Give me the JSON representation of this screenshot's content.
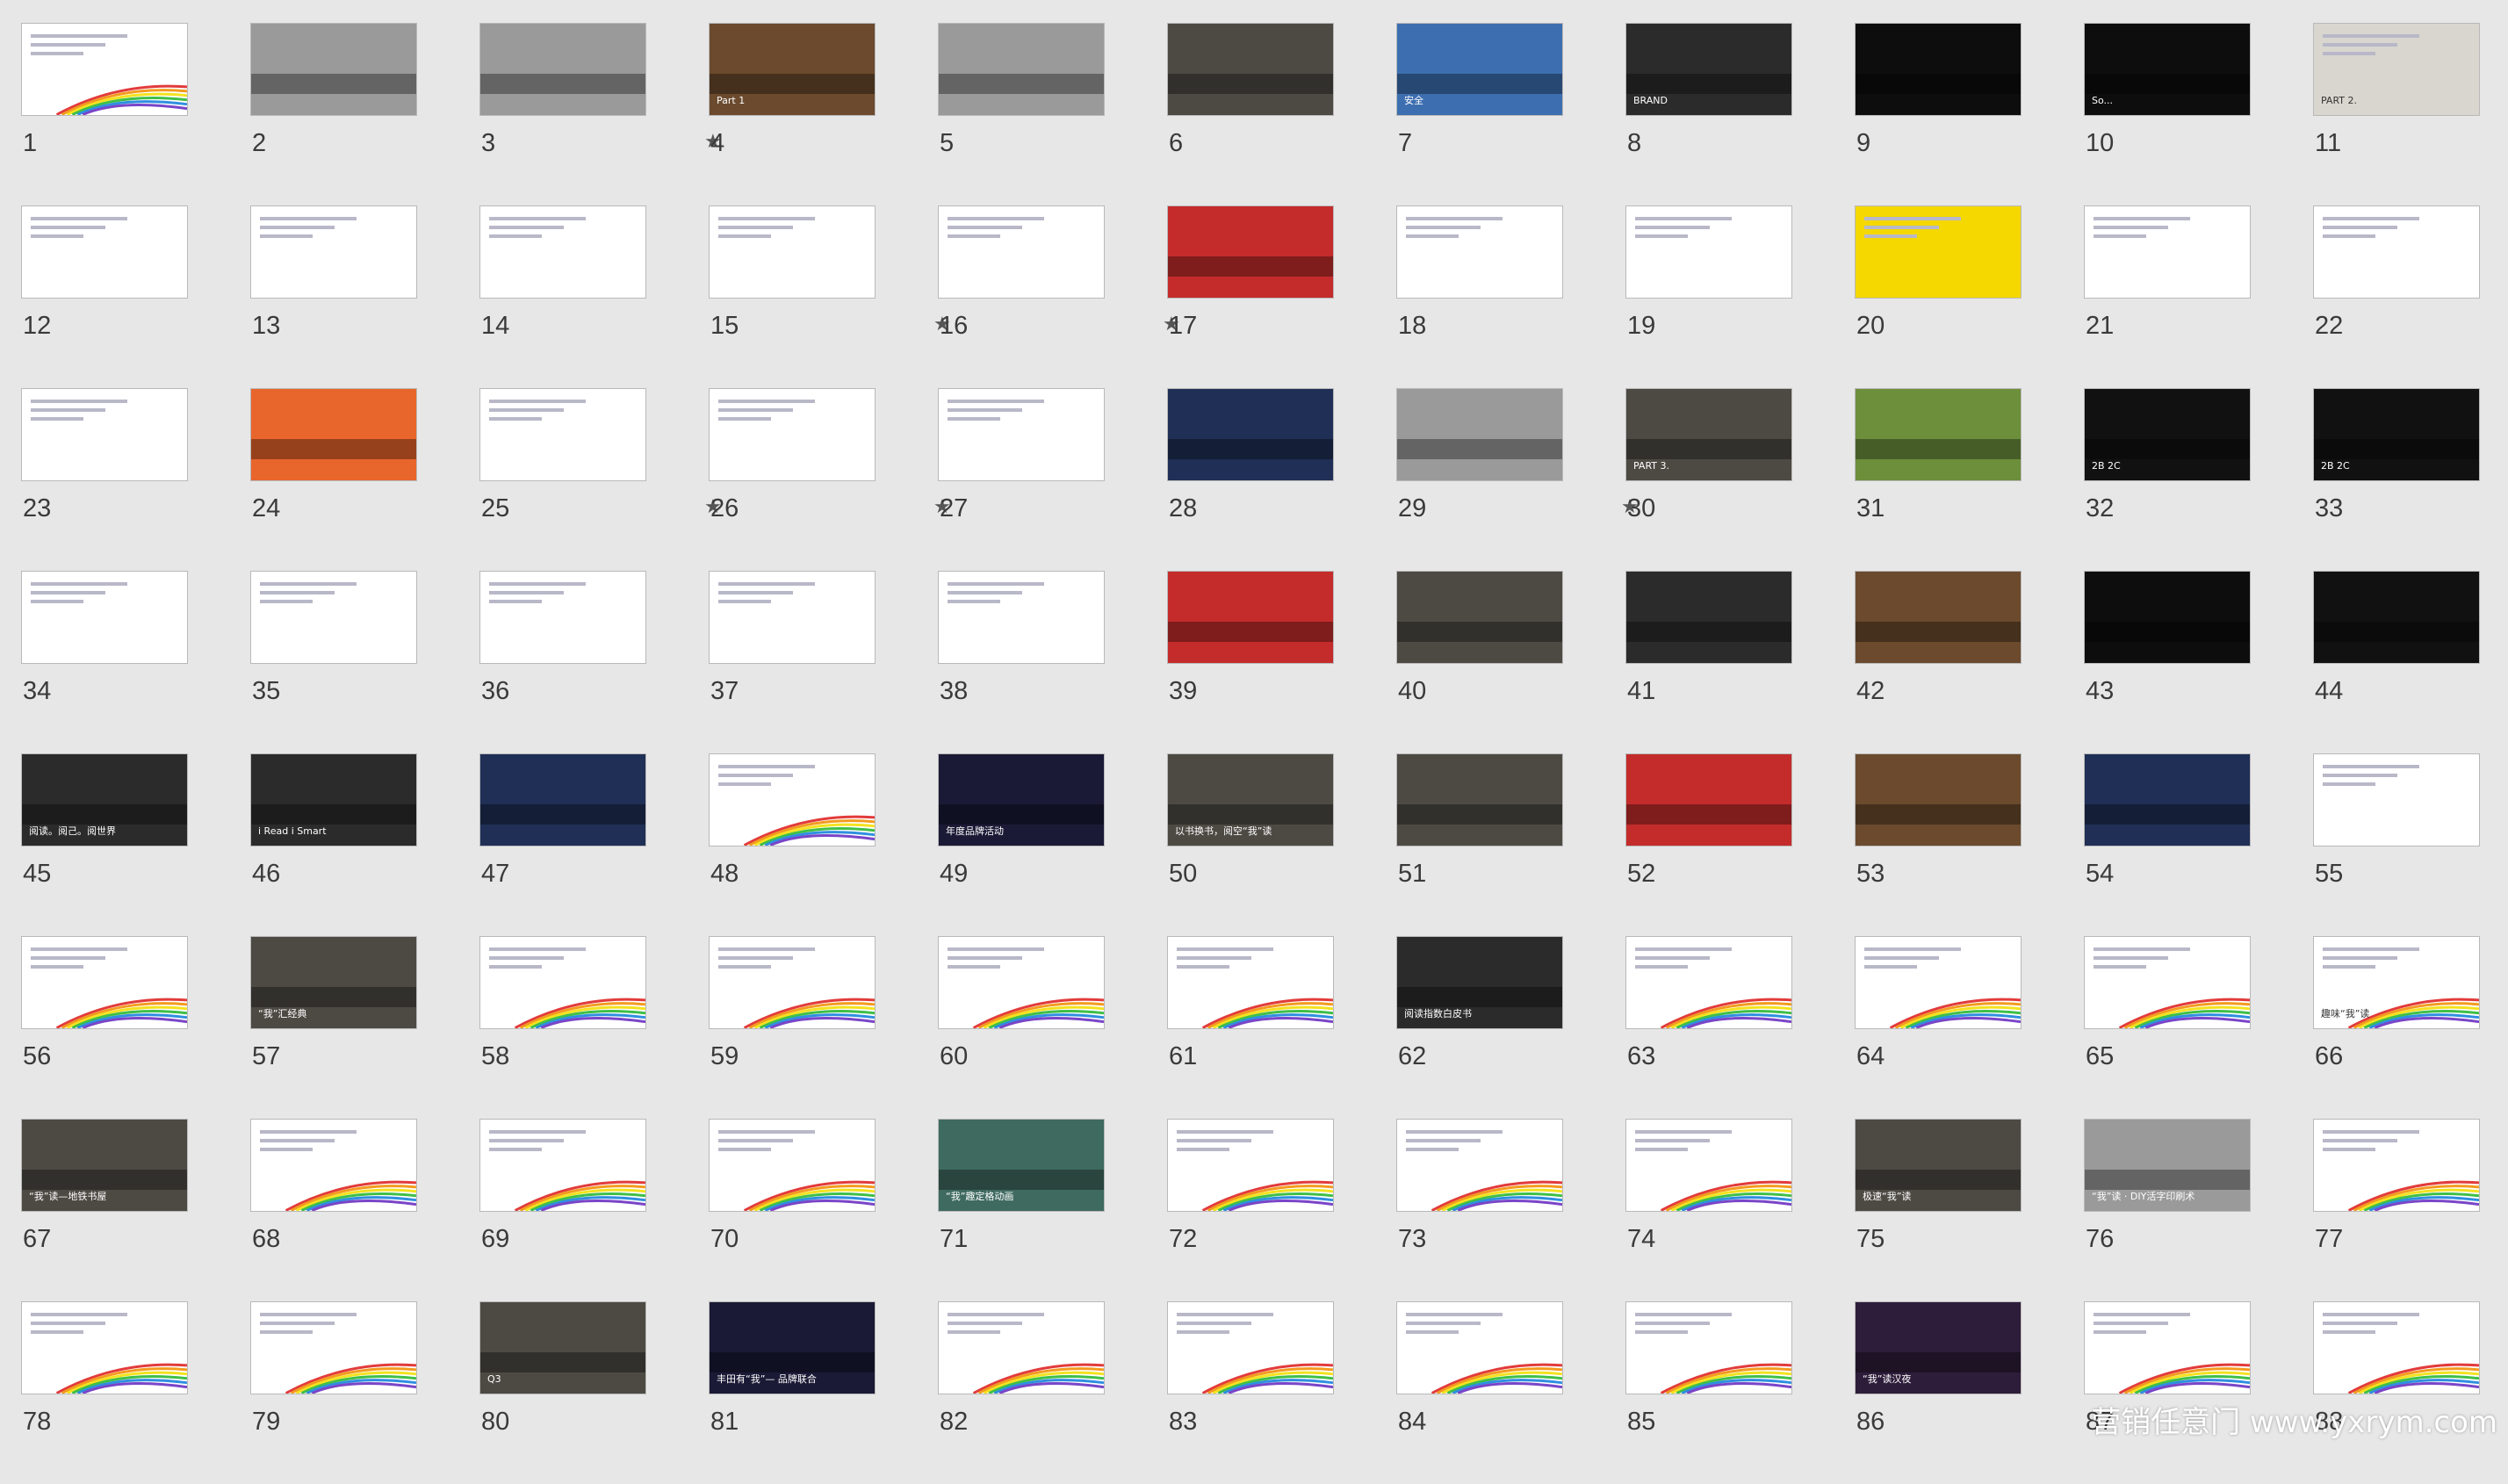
{
  "slides": [
    {
      "n": "1",
      "theme": "rainbow",
      "text": ""
    },
    {
      "n": "2",
      "theme": "gray",
      "text": ""
    },
    {
      "n": "3",
      "theme": "gray",
      "text": "",
      "star": true
    },
    {
      "n": "4",
      "theme": "brown",
      "text": "Part 1"
    },
    {
      "n": "5",
      "theme": "gray",
      "text": ""
    },
    {
      "n": "6",
      "theme": "photo",
      "text": ""
    },
    {
      "n": "7",
      "theme": "blue",
      "text": "安全"
    },
    {
      "n": "8",
      "theme": "dark",
      "text": "BRAND"
    },
    {
      "n": "9",
      "theme": "black",
      "text": ""
    },
    {
      "n": "10",
      "theme": "black",
      "text": "So..."
    },
    {
      "n": "11",
      "theme": "light",
      "text": "PART 2."
    },
    {
      "n": "12",
      "theme": "white",
      "text": ""
    },
    {
      "n": "13",
      "theme": "white",
      "text": ""
    },
    {
      "n": "14",
      "theme": "white",
      "text": ""
    },
    {
      "n": "15",
      "theme": "white",
      "text": "",
      "star": true
    },
    {
      "n": "16",
      "theme": "white",
      "text": "",
      "star": true
    },
    {
      "n": "17",
      "theme": "red",
      "text": ""
    },
    {
      "n": "18",
      "theme": "white",
      "text": ""
    },
    {
      "n": "19",
      "theme": "white",
      "text": ""
    },
    {
      "n": "20",
      "theme": "yellow",
      "text": ""
    },
    {
      "n": "21",
      "theme": "white",
      "text": ""
    },
    {
      "n": "22",
      "theme": "white",
      "text": ""
    },
    {
      "n": "23",
      "theme": "white",
      "text": ""
    },
    {
      "n": "24",
      "theme": "orange",
      "text": ""
    },
    {
      "n": "25",
      "theme": "circle",
      "text": "",
      "star": true
    },
    {
      "n": "26",
      "theme": "pyramid",
      "text": "",
      "star": true
    },
    {
      "n": "27",
      "theme": "white",
      "text": ""
    },
    {
      "n": "28",
      "theme": "navy",
      "text": ""
    },
    {
      "n": "29",
      "theme": "gray",
      "text": "",
      "star": true
    },
    {
      "n": "30",
      "theme": "photo",
      "text": "PART 3."
    },
    {
      "n": "31",
      "theme": "green",
      "text": ""
    },
    {
      "n": "32",
      "theme": "bw",
      "text": "2B  2C"
    },
    {
      "n": "33",
      "theme": "bw",
      "text": "2B  2C"
    },
    {
      "n": "34",
      "theme": "pie",
      "text": ""
    },
    {
      "n": "35",
      "theme": "bars",
      "text": ""
    },
    {
      "n": "36",
      "theme": "bars",
      "text": ""
    },
    {
      "n": "37",
      "theme": "white",
      "text": ""
    },
    {
      "n": "38",
      "theme": "white",
      "text": ""
    },
    {
      "n": "39",
      "theme": "red",
      "text": ""
    },
    {
      "n": "40",
      "theme": "photo",
      "text": ""
    },
    {
      "n": "41",
      "theme": "dark",
      "text": ""
    },
    {
      "n": "42",
      "theme": "brown",
      "text": ""
    },
    {
      "n": "43",
      "theme": "black",
      "text": ""
    },
    {
      "n": "44",
      "theme": "bw",
      "text": ""
    },
    {
      "n": "45",
      "theme": "dark",
      "text": "阅读。阅己。阅世界"
    },
    {
      "n": "46",
      "theme": "dark",
      "text": "i Read  i Smart"
    },
    {
      "n": "47",
      "theme": "navy",
      "text": ""
    },
    {
      "n": "48",
      "theme": "rainbow",
      "text": ""
    },
    {
      "n": "49",
      "theme": "night",
      "text": "年度品牌活动"
    },
    {
      "n": "50",
      "theme": "photo",
      "text": "以书换书，阅空“我”读"
    },
    {
      "n": "51",
      "theme": "photo",
      "text": ""
    },
    {
      "n": "52",
      "theme": "red",
      "text": ""
    },
    {
      "n": "53",
      "theme": "brown",
      "text": ""
    },
    {
      "n": "54",
      "theme": "navy",
      "text": ""
    },
    {
      "n": "55",
      "theme": "white",
      "text": ""
    },
    {
      "n": "56",
      "theme": "rainbow",
      "text": ""
    },
    {
      "n": "57",
      "theme": "photo",
      "text": "“我”汇经典"
    },
    {
      "n": "58",
      "theme": "rainbow",
      "text": ""
    },
    {
      "n": "59",
      "theme": "rainbow",
      "text": ""
    },
    {
      "n": "60",
      "theme": "rainbow",
      "text": ""
    },
    {
      "n": "61",
      "theme": "rainbow",
      "text": ""
    },
    {
      "n": "62",
      "theme": "dark",
      "text": "阅读指数白皮书"
    },
    {
      "n": "63",
      "theme": "rainbow",
      "text": ""
    },
    {
      "n": "64",
      "theme": "rainbow",
      "text": ""
    },
    {
      "n": "65",
      "theme": "rainbow",
      "text": ""
    },
    {
      "n": "66",
      "theme": "rainbow",
      "text": "趣味“我”读"
    },
    {
      "n": "67",
      "theme": "photo",
      "text": "“我”读—地铁书屋"
    },
    {
      "n": "68",
      "theme": "rainbow",
      "text": ""
    },
    {
      "n": "69",
      "theme": "rainbow",
      "text": ""
    },
    {
      "n": "70",
      "theme": "rainbow",
      "text": ""
    },
    {
      "n": "71",
      "theme": "teal",
      "text": "“我”趣定格动画"
    },
    {
      "n": "72",
      "theme": "rainbow",
      "text": ""
    },
    {
      "n": "73",
      "theme": "rainbow",
      "text": ""
    },
    {
      "n": "74",
      "theme": "rainbow",
      "text": ""
    },
    {
      "n": "75",
      "theme": "photo",
      "text": "极速“我”读"
    },
    {
      "n": "76",
      "theme": "gray",
      "text": "“我”读 · DIY活字印刷术"
    },
    {
      "n": "77",
      "theme": "rainbow",
      "text": ""
    },
    {
      "n": "78",
      "theme": "rainbow",
      "text": ""
    },
    {
      "n": "79",
      "theme": "rainbow",
      "text": ""
    },
    {
      "n": "80",
      "theme": "photo",
      "text": "Q3"
    },
    {
      "n": "81",
      "theme": "night",
      "text": "丰田有“我”— 品牌联合"
    },
    {
      "n": "82",
      "theme": "rainbow",
      "text": ""
    },
    {
      "n": "83",
      "theme": "rainbow",
      "text": ""
    },
    {
      "n": "84",
      "theme": "rainbow",
      "text": ""
    },
    {
      "n": "85",
      "theme": "rainbow",
      "text": ""
    },
    {
      "n": "86",
      "theme": "space",
      "text": "“我”读汉夜"
    },
    {
      "n": "87",
      "theme": "rainbow",
      "text": ""
    },
    {
      "n": "88",
      "theme": "rainbow",
      "text": ""
    }
  ],
  "themes": {
    "white": "#ffffff",
    "gray": "#9a9a9a",
    "dark": "#2b2b2b",
    "black": "#0d0d0d",
    "brown": "#6b4a2d",
    "photo": "#4d4a44",
    "blue": "#3d6fb0",
    "red": "#c42b2b",
    "navy": "#1f2f55",
    "orange": "#e8652b",
    "green": "#6d8f3c",
    "teal": "#3f6a5f",
    "night": "#1a1a36",
    "space": "#2e1d3a",
    "light": "#d9d6cf",
    "yellow": "#f4d800",
    "bw": "#111111",
    "pie": "#ffffff",
    "bars": "#ffffff",
    "circle": "#ffffff",
    "pyramid": "#ffffff",
    "rainbow": "#ffffff"
  },
  "watermark": "营销任意门 www.yxrym.com"
}
